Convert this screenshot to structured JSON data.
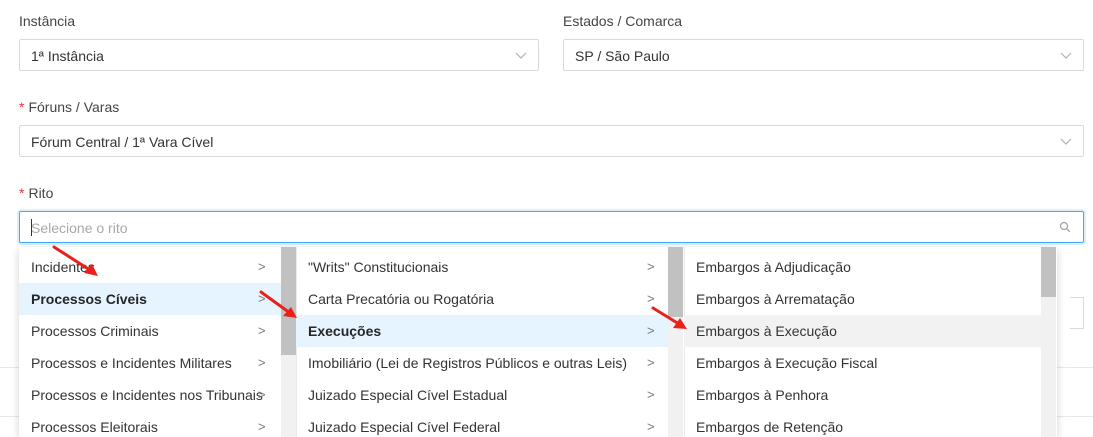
{
  "fields": {
    "instancia": {
      "label": "Instância",
      "value": "1ª Instância"
    },
    "estados": {
      "label": "Estados / Comarca",
      "value": "SP / São Paulo"
    },
    "foruns": {
      "required_mark": "*",
      "label": "Fóruns / Varas",
      "value": "Fórum Central / 1ª Vara Cível"
    },
    "rito": {
      "required_mark": "*",
      "label": "Rito",
      "placeholder": "Selecione o rito"
    }
  },
  "icons": {
    "chevron": "chevron-down-icon",
    "search": "search-icon",
    "submenu": "chevron-right-icon"
  },
  "colors": {
    "required": "#e5323e",
    "focus_border": "#40a9ff",
    "active_bg": "#e6f4ff",
    "hover_bg": "#f2f2f2",
    "annotation_arrow": "#e8221b"
  },
  "cascader": {
    "column1": [
      {
        "label": "Incidentes",
        "has_children": true,
        "active": false
      },
      {
        "label": "Processos Cíveis",
        "has_children": true,
        "active": true
      },
      {
        "label": "Processos Criminais",
        "has_children": true,
        "active": false
      },
      {
        "label": "Processos e Incidentes Militares",
        "has_children": true,
        "active": false
      },
      {
        "label": "Processos e Incidentes nos Tribunais",
        "has_children": true,
        "active": false
      },
      {
        "label": "Processos Eleitorais",
        "has_children": true,
        "active": false
      }
    ],
    "column2": [
      {
        "label": "\"Writs\" Constitucionais",
        "has_children": true,
        "active": false
      },
      {
        "label": "Carta Precatória ou Rogatória",
        "has_children": true,
        "active": false
      },
      {
        "label": "Execuções",
        "has_children": true,
        "active": true
      },
      {
        "label": "Imobiliário (Lei de Registros Públicos e outras Leis)",
        "has_children": true,
        "active": false
      },
      {
        "label": "Juizado Especial Cível Estadual",
        "has_children": true,
        "active": false
      },
      {
        "label": "Juizado Especial Cível Federal",
        "has_children": true,
        "active": false
      }
    ],
    "column3": [
      {
        "label": "Embargos à Adjudicação",
        "hover": false
      },
      {
        "label": "Embargos à Arrematação",
        "hover": false
      },
      {
        "label": "Embargos à Execução",
        "hover": true
      },
      {
        "label": "Embargos à Execução Fiscal",
        "hover": false
      },
      {
        "label": "Embargos à Penhora",
        "hover": false
      },
      {
        "label": "Embargos de Retenção",
        "hover": false
      }
    ],
    "submenu_glyph": ">"
  }
}
